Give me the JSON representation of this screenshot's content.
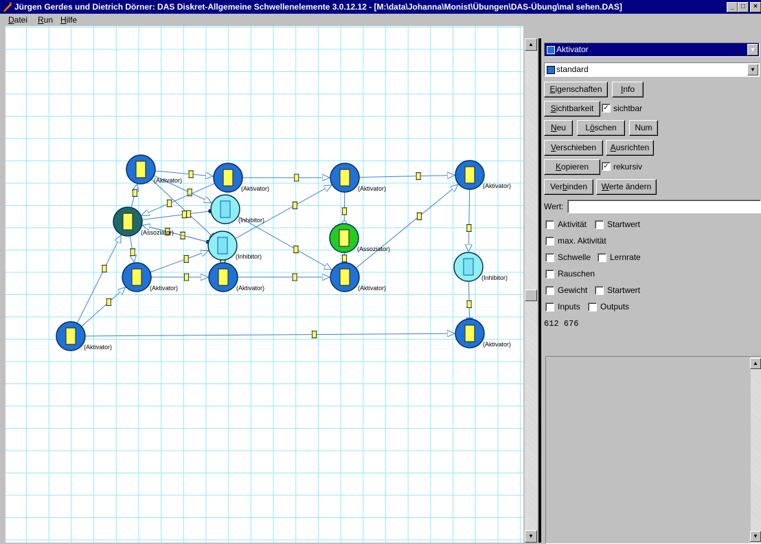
{
  "window": {
    "title": "Jürgen Gerdes und Dietrich Dörner: DAS Diskret-Allgemeine Schwellenelemente 3.0.12.12 - [M:\\data\\Johanna\\Monist\\Übungen\\DAS-Übung\\mal sehen.DAS]",
    "controls": [
      "_",
      "□",
      "×"
    ]
  },
  "menu": [
    {
      "first": "D",
      "rest": "atei"
    },
    {
      "first": "R",
      "rest": "un"
    },
    {
      "first": "H",
      "rest": "ilfe"
    }
  ],
  "network": {
    "nodes": [
      {
        "type": "aktivator",
        "label": "(Aktivator)"
      },
      {
        "type": "aktivator",
        "label": "(Aktivator)"
      },
      {
        "type": "aktivator",
        "label": "(Aktivator)"
      },
      {
        "type": "aktivator",
        "label": "(Aktivator)"
      },
      {
        "type": "inhibitor",
        "label": "(Inhibitor)"
      },
      {
        "type": "assoziator-dark",
        "label": "(Assoziator)"
      },
      {
        "type": "assoziator-green",
        "label": "(Assoziator)"
      },
      {
        "type": "inhibitor",
        "label": "(Inhibitor)"
      },
      {
        "type": "aktivator",
        "label": "(Aktivator)"
      },
      {
        "type": "aktivator",
        "label": "(Aktivator)"
      },
      {
        "type": "aktivator",
        "label": "(Aktivator)"
      },
      {
        "type": "inhibitor",
        "label": "(Inhibitor)"
      },
      {
        "type": "aktivator",
        "label": "(Aktivator)"
      },
      {
        "type": "aktivator",
        "label": "(Aktivator)"
      }
    ],
    "colors": {
      "aktivator": "#1f72d6",
      "inhibitor": "#8ff0f0",
      "assoziator-dark": "#1f6a66",
      "assoziator-green": "#22cc22",
      "link": "#3a7fd8",
      "grid": "#8fe8ff"
    }
  },
  "panel": {
    "type_combo": "Aktivator",
    "style_combo": "standard",
    "buttons": {
      "eigenschaften": {
        "first": "E",
        "rest": "igenschaften"
      },
      "info": {
        "first": "I",
        "rest": "nfo"
      },
      "sichtbarkeit": {
        "first": "S",
        "rest": "ichtbarkeit"
      },
      "neu": {
        "first": "N",
        "rest": "eu"
      },
      "loeschen": {
        "pre": "L",
        "u": "ö",
        "post": "schen"
      },
      "num": "Num",
      "verschieben": {
        "first": "V",
        "rest": "erschieben"
      },
      "ausrichten": {
        "first": "A",
        "rest": "usrichten"
      },
      "kopieren": {
        "first": "K",
        "rest": "opieren"
      },
      "verbinden": {
        "pre": "Ver",
        "u": "b",
        "post": "inden"
      },
      "werte_aendern": {
        "first": "W",
        "rest": "erte ändern"
      }
    },
    "checkboxes": {
      "sichtbar": {
        "label": "sichtbar",
        "checked": true
      },
      "rekursiv": {
        "label": "rekursiv",
        "checked": true
      },
      "aktivitaet": {
        "label": "Aktivität",
        "checked": false
      },
      "startwert1": {
        "label": "Startwert",
        "checked": false
      },
      "max_aktivitaet": {
        "label": "max. Aktivität",
        "checked": false
      },
      "schwelle": {
        "label": "Schwelle",
        "checked": false
      },
      "lernrate": {
        "label": "Lernrate",
        "checked": false
      },
      "rauschen": {
        "label": "Rauschen",
        "checked": false
      },
      "gewicht": {
        "label": "Gewicht",
        "checked": false
      },
      "startwert2": {
        "label": "Startwert",
        "checked": false
      },
      "inputs": {
        "label": "Inputs",
        "checked": false
      },
      "outputs": {
        "label": "Outputs",
        "checked": false
      }
    },
    "wert_label": "Wert:",
    "wert_value": "",
    "coords": "612  676"
  }
}
